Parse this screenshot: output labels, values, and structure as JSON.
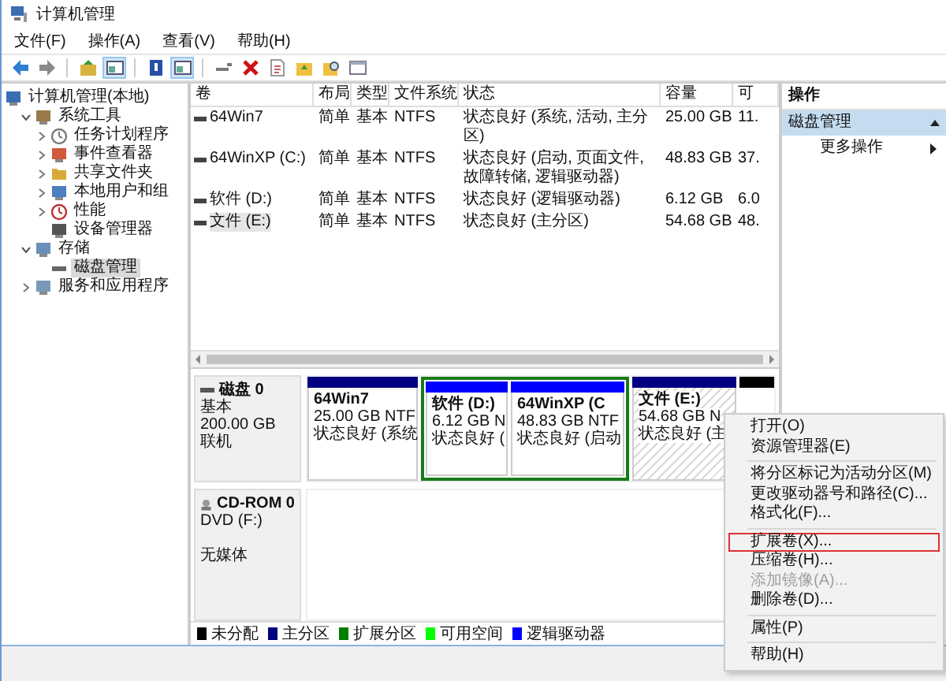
{
  "window": {
    "title": "计算机管理"
  },
  "menu": [
    "文件(F)",
    "操作(A)",
    "查看(V)",
    "帮助(H)"
  ],
  "toolbar": [
    [
      {
        "kind": "back",
        "selected": false
      },
      {
        "kind": "forward",
        "selected": false
      }
    ],
    [
      {
        "kind": "up",
        "selected": false
      },
      {
        "kind": "view",
        "selected": true
      }
    ],
    [
      {
        "kind": "help",
        "selected": false
      },
      {
        "kind": "view",
        "selected": true
      }
    ],
    [
      {
        "kind": "connect",
        "selected": false
      },
      {
        "kind": "delete",
        "selected": false
      },
      {
        "kind": "document",
        "selected": false
      },
      {
        "kind": "folder",
        "selected": false
      },
      {
        "kind": "search",
        "selected": false
      },
      {
        "kind": "window",
        "selected": false
      }
    ]
  ],
  "tree": [
    {
      "label": "计算机管理(本地)",
      "selected": false,
      "children": [
        {
          "label": "系统工具",
          "expanded": true,
          "selected": false,
          "children": [
            {
              "label": "任务计划程序",
              "expanded": false,
              "selected": false
            },
            {
              "label": "事件查看器",
              "expanded": false,
              "selected": false
            },
            {
              "label": "共享文件夹",
              "expanded": false,
              "selected": false
            },
            {
              "label": "本地用户和组",
              "expanded": false,
              "selected": false
            },
            {
              "label": "性能",
              "expanded": false,
              "selected": false
            },
            {
              "label": "设备管理器",
              "selected": false
            }
          ]
        },
        {
          "label": "存储",
          "expanded": true,
          "selected": false,
          "children": [
            {
              "label": "磁盘管理",
              "selected": true
            }
          ]
        },
        {
          "label": "服务和应用程序",
          "expanded": false,
          "selected": false
        }
      ]
    }
  ],
  "volumes": {
    "columns": [
      "卷",
      "布局",
      "类型",
      "文件系统",
      "状态",
      "容量",
      "可"
    ],
    "rows": [
      {
        "selected": false,
        "cells": [
          "64Win7",
          "简单",
          "基本",
          "NTFS",
          "状态良好 (系统, 活动, 主分区)",
          "25.00 GB",
          "11."
        ]
      },
      {
        "selected": false,
        "cells": [
          "64WinXP  (C:)",
          "简单",
          "基本",
          "NTFS",
          "状态良好 (启动, 页面文件, 故障转储, 逻辑驱动器)",
          "48.83 GB",
          "37."
        ]
      },
      {
        "selected": false,
        "cells": [
          "软件 (D:)",
          "简单",
          "基本",
          "NTFS",
          "状态良好 (逻辑驱动器)",
          "6.12 GB",
          "6.0"
        ]
      },
      {
        "selected": true,
        "cells": [
          "文件 (E:)",
          "简单",
          "基本",
          "NTFS",
          "状态良好 (主分区)",
          "54.68 GB",
          "48."
        ]
      }
    ]
  },
  "disks": [
    {
      "kind": "disk",
      "name": "磁盘 0",
      "lines": [
        "基本",
        "200.00 GB",
        "联机"
      ],
      "partitions": [
        {
          "kind": "primary",
          "title": "64Win7",
          "size": "25.00 GB NTF",
          "status": "状态良好 (系统",
          "selected": false
        },
        {
          "kind": "extended",
          "children": [
            {
              "kind": "logical",
              "title": "软件  (D:)",
              "size": "6.12 GB N",
              "status": "状态良好 (",
              "selected": false
            },
            {
              "kind": "logical",
              "title": "64WinXP  (C",
              "size": "48.83 GB NTF",
              "status": "状态良好 (启动",
              "selected": false
            }
          ]
        },
        {
          "kind": "primary",
          "title": "文件  (E:)",
          "size": "54.68 GB N",
          "status": "状态良好 (主",
          "selected": true
        },
        {
          "kind": "unallocated"
        }
      ]
    },
    {
      "kind": "cdrom",
      "name": "CD-ROM 0",
      "lines": [
        "DVD (F:)",
        "无媒体"
      ]
    }
  ],
  "legend": [
    {
      "label": "未分配",
      "color": "#000000"
    },
    {
      "label": "主分区",
      "color": "#000080"
    },
    {
      "label": "扩展分区",
      "color": "#008000"
    },
    {
      "label": "可用空间",
      "color": "#00ff00"
    },
    {
      "label": "逻辑驱动器",
      "color": "#0000ff"
    }
  ],
  "actions": {
    "title": "操作",
    "section": {
      "label": "磁盘管理",
      "expanded": true
    },
    "items": [
      "更多操作"
    ]
  },
  "context_menu": [
    {
      "kind": "item",
      "label": "打开(O)",
      "disabled": false,
      "highlighted": false
    },
    {
      "kind": "item",
      "label": "资源管理器(E)",
      "disabled": false,
      "highlighted": false
    },
    {
      "kind": "separator"
    },
    {
      "kind": "item",
      "label": "将分区标记为活动分区(M)",
      "disabled": false,
      "highlighted": false
    },
    {
      "kind": "item",
      "label": "更改驱动器号和路径(C)...",
      "disabled": false,
      "highlighted": false
    },
    {
      "kind": "item",
      "label": "格式化(F)...",
      "disabled": false,
      "highlighted": false
    },
    {
      "kind": "separator"
    },
    {
      "kind": "item",
      "label": "扩展卷(X)...",
      "disabled": false,
      "highlighted": true
    },
    {
      "kind": "item",
      "label": "压缩卷(H)...",
      "disabled": false,
      "highlighted": false
    },
    {
      "kind": "item",
      "label": "添加镜像(A)...",
      "disabled": true,
      "highlighted": false
    },
    {
      "kind": "item",
      "label": "删除卷(D)...",
      "disabled": false,
      "highlighted": false
    },
    {
      "kind": "separator"
    },
    {
      "kind": "item",
      "label": "属性(P)",
      "disabled": false,
      "highlighted": false
    },
    {
      "kind": "separator"
    },
    {
      "kind": "item",
      "label": "帮助(H)",
      "disabled": false,
      "highlighted": false
    }
  ]
}
